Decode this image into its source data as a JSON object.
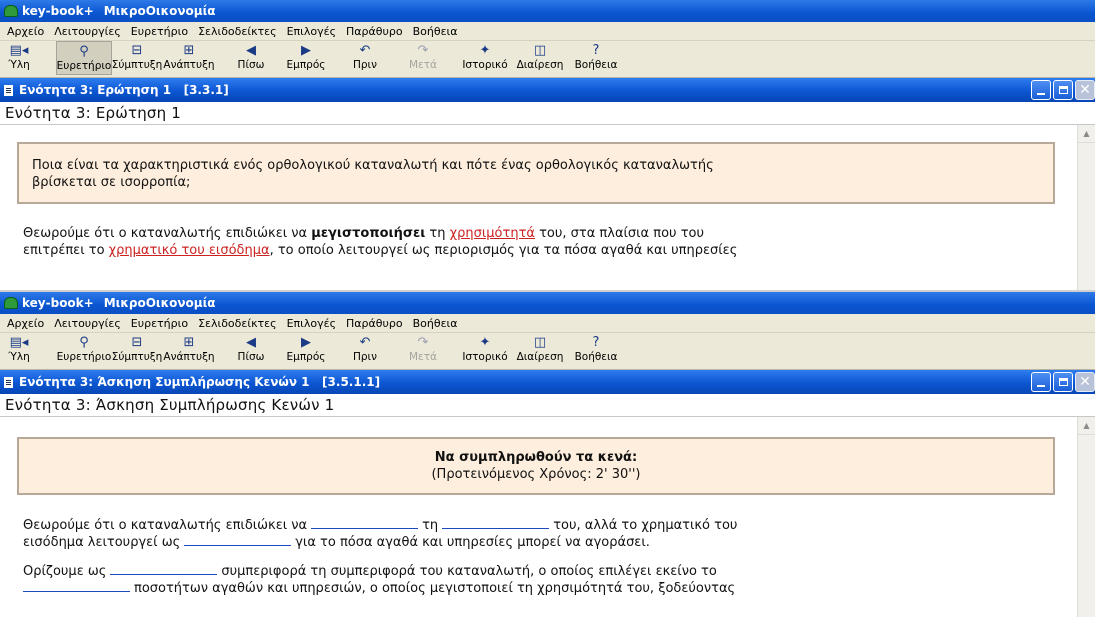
{
  "app": {
    "name": "key-book+",
    "title": "ΜικροΟικονομία"
  },
  "menu": [
    "Αρχείο",
    "Λειτουργίες",
    "Ευρετήριο",
    "Σελιδοδείκτες",
    "Επιλογές",
    "Παράθυρο",
    "Βοήθεια"
  ],
  "toolbar": {
    "yli": "Ύλη",
    "evretirio": "Ευρετήριο",
    "symptyxi": "Σύμπτυξη",
    "anaptyxi": "Ανάπτυξη",
    "piso": "Πίσω",
    "embros": "Εμπρός",
    "prin": "Πριν",
    "meta": "Μετά",
    "istoriko": "Ιστορικό",
    "diairesi": "Διαίρεση",
    "voitheia": "Βοήθεια"
  },
  "win1": {
    "doc_title": "Ενότητα 3: Ερώτηση 1   [3.3.1]",
    "heading": "Ενότητα 3: Ερώτηση 1",
    "question_l1": "Ποια είναι τα χαρακτηριστικά ενός ορθολογικού καταναλωτή και πότε ένας ορθολογικός καταναλωτής",
    "question_l2": "βρίσκεται σε ισορροπία;",
    "answer_l1_a": "Θεωρούμε ότι ο καταναλωτής επιδιώκει να ",
    "answer_l1_bold": "μεγιστοποιήσει",
    "answer_l1_b": " τη ",
    "answer_l1_link": "χρησιμότητά",
    "answer_l1_c": " του, στα πλαίσια που του",
    "answer_l2_a": "επιτρέπει το ",
    "answer_l2_link": "χρηματικό του εισόδημα",
    "answer_l2_b": ", το οποίο λειτουργεί ως περιορισμός για τα πόσα αγαθά και υπηρεσίες"
  },
  "win2": {
    "doc_title": "Ενότητα 3: Άσκηση Συμπλήρωσης Κενών 1   [3.5.1.1]",
    "heading": "Ενότητα 3: Άσκηση Συμπλήρωσης Κενών 1",
    "instr_title": "Να συμπληρωθούν τα κενά:",
    "instr_time": "(Προτεινόμενος Χρόνος: 2' 30'')",
    "p1_a": "Θεωρούμε ότι ο καταναλωτής επιδιώκει να",
    "p1_b": "τη",
    "p1_c": "του, αλλά το χρηματικό του",
    "p2_a": "εισόδημα λειτουργεί ως",
    "p2_b": "για το πόσα αγαθά και υπηρεσίες μπορεί να αγοράσει.",
    "p3_a": "Ορίζουμε ως",
    "p3_b": "συμπεριφορά τη συμπεριφορά του καταναλωτή, ο οποίος επιλέγει εκείνο το",
    "p4_b": "ποσοτήτων αγαθών και υπηρεσιών, ο οποίος μεγιστοποιεί τη χρησιμότητά του, ξοδεύοντας"
  }
}
